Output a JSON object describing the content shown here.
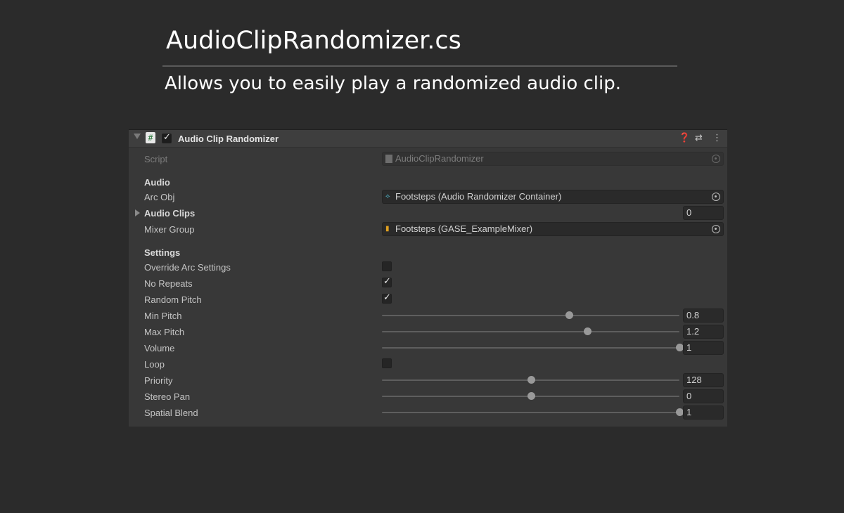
{
  "slide": {
    "title": "AudioClipRandomizer.cs",
    "subtitle": "Allows you to easily play a randomized audio clip."
  },
  "component": {
    "name": "Audio Clip Randomizer",
    "enabled": true,
    "header_icons": [
      "help-icon",
      "preset-icon",
      "more-menu-icon"
    ]
  },
  "script": {
    "label": "Script",
    "value": "AudioClipRandomizer"
  },
  "audio": {
    "header": "Audio",
    "arc_obj": {
      "label": "Arc Obj",
      "value": "Footsteps (Audio Randomizer Container)"
    },
    "audio_clips": {
      "label": "Audio Clips",
      "count": "0"
    },
    "mixer_group": {
      "label": "Mixer Group",
      "value": "Footsteps (GASE_ExampleMixer)"
    }
  },
  "settings": {
    "header": "Settings",
    "override_arc_settings": {
      "label": "Override Arc Settings",
      "checked": false
    },
    "no_repeats": {
      "label": "No Repeats",
      "checked": true
    },
    "random_pitch": {
      "label": "Random Pitch",
      "checked": true
    },
    "min_pitch": {
      "label": "Min Pitch",
      "value": "0.8",
      "fraction": 0.63
    },
    "max_pitch": {
      "label": "Max Pitch",
      "value": "1.2",
      "fraction": 0.69
    },
    "volume": {
      "label": "Volume",
      "value": "1",
      "fraction": 1.0
    },
    "loop": {
      "label": "Loop",
      "checked": false
    },
    "priority": {
      "label": "Priority",
      "value": "128",
      "fraction": 0.5
    },
    "stereo_pan": {
      "label": "Stereo Pan",
      "value": "0",
      "fraction": 0.5
    },
    "spatial_blend": {
      "label": "Spatial Blend",
      "value": "1",
      "fraction": 1.0
    }
  }
}
